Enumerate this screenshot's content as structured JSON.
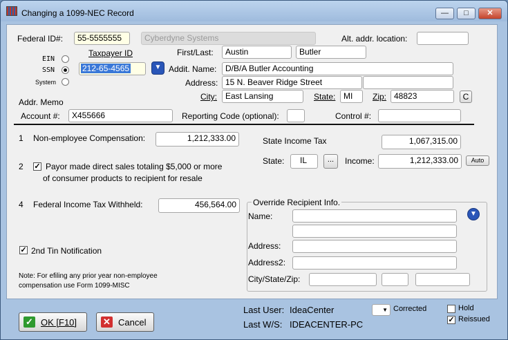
{
  "window": {
    "title": "Changing a 1099-NEC Record"
  },
  "header": {
    "federal_id_label": "Federal ID#:",
    "federal_id_value": "55-5555555",
    "company_name": "Cyberdyne Systems",
    "alt_addr_label": "Alt. addr. location:",
    "alt_addr_value": "",
    "ein_label": "EIN",
    "ssn_label": "SSN",
    "system_label": "System",
    "taxpayer_id_label": "Taxpayer ID",
    "taxpayer_id_value": "212-65-4565",
    "first_last_label": "First/Last:",
    "first_name": "Austin",
    "last_name": "Butler",
    "addit_name_label": "Addit. Name:",
    "addit_name_value": "D/B/A Butler Accounting",
    "address_label": "Address:",
    "address_value": "15 N. Beaver Ridge Street",
    "address2_value": "",
    "city_label": "City:",
    "city_value": "East Lansing",
    "state_label": "State:",
    "state_value": "MI",
    "zip_label": "Zip:",
    "zip_value": "48823",
    "c_button": "C",
    "addr_memo_label": "Addr. Memo",
    "account_label": "Account #:",
    "account_value": "X455666",
    "reporting_code_label": "Reporting Code (optional):",
    "reporting_code_value": "",
    "control_label": "Control #:",
    "control_value": ""
  },
  "body": {
    "box1_num": "1",
    "box1_label": "Non-employee Compensation:",
    "box1_value": "1,212,333.00",
    "box2_num": "2",
    "box2_label_line1": "Payor made direct sales totaling $5,000 or more",
    "box2_label_line2": "of consumer products to recipient for resale",
    "box4_num": "4",
    "box4_label": "Federal Income Tax Withheld:",
    "box4_value": "456,564.00",
    "second_tin_label": "2nd Tin Notification",
    "note_line1": "Note:  For efiling any prior year non-employee",
    "note_line2": "compensation use Form 1099-MISC",
    "state_income_tax_label": "State Income Tax",
    "state_income_tax_value": "1,067,315.00",
    "state_label": "State:",
    "state_value": "IL",
    "state_lookup_button": "...",
    "income_label": "Income:",
    "income_value": "1,212,333.00",
    "auto_button": "Auto",
    "override": {
      "title": "Override Recipient Info.",
      "name_label": "Name:",
      "address_label": "Address:",
      "address2_label": "Address2:",
      "csz_label": "City/State/Zip:"
    }
  },
  "footer": {
    "ok_label": "OK [F10]",
    "cancel_label": "Cancel",
    "last_user_label": "Last User:",
    "last_user_value": "IdeaCenter",
    "last_ws_label": "Last W/S:",
    "last_ws_value": "IDEACENTER-PC",
    "corrected_label": "Corrected",
    "hold_label": "Hold",
    "reissued_label": "Reissued"
  },
  "icons": {
    "app": "form-grid-icon",
    "lookup": "chevron-down-circle-icon",
    "ok": "check-icon",
    "cancel": "x-icon"
  }
}
